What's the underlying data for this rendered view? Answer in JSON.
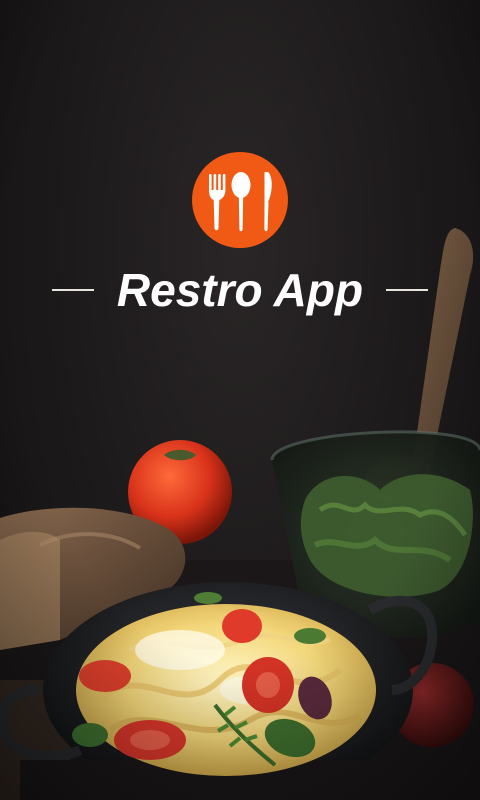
{
  "app": {
    "title": "Restro App",
    "logo_icon": "fork-spoon-knife-icon",
    "accent_color": "#f05a14",
    "background_color": "#1c191a"
  }
}
